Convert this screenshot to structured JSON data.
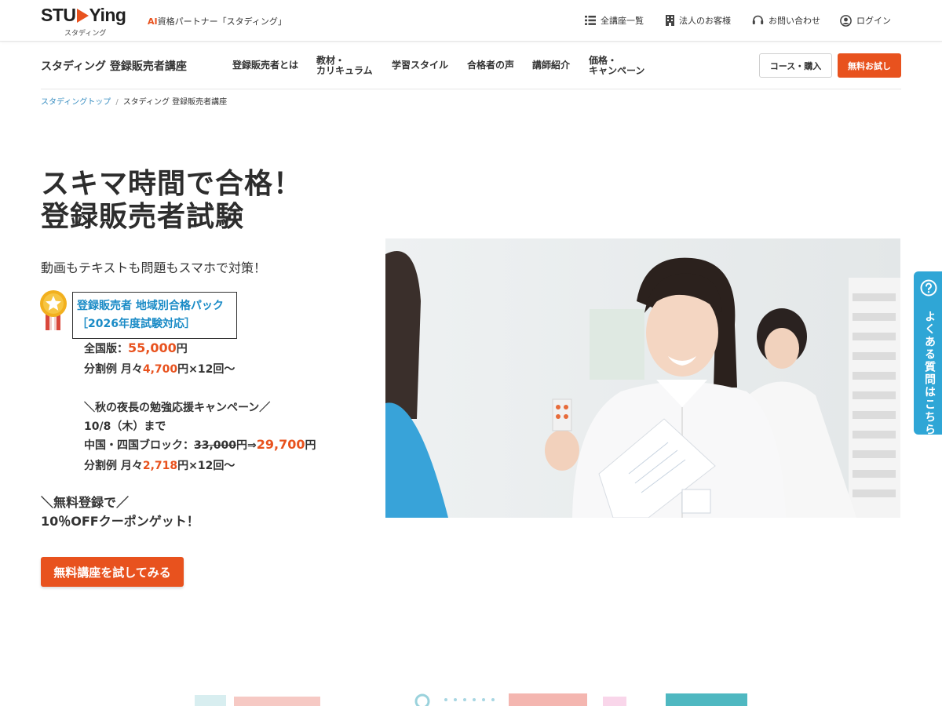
{
  "header": {
    "logo_word_1": "STU",
    "logo_word_2": "Ying",
    "logo_sub": "スタディング",
    "tagline_ai": "AI",
    "tagline_rest": "資格パートナー「スタディング」",
    "utility": [
      {
        "label": "全講座一覧",
        "icon": "list-icon"
      },
      {
        "label": "法人のお客様",
        "icon": "building-icon"
      },
      {
        "label": "お問い合わせ",
        "icon": "headset-icon"
      },
      {
        "label": "ログイン",
        "icon": "user-circle-icon"
      }
    ]
  },
  "course_nav": {
    "title": "スタディング 登録販売者講座",
    "items": [
      {
        "label": "登録販売者とは"
      },
      {
        "label": "教材・\nカリキュラム"
      },
      {
        "label": "学習スタイル"
      },
      {
        "label": "合格者の声"
      },
      {
        "label": "講師紹介"
      },
      {
        "label": "価格・\nキャンペーン"
      }
    ],
    "course_button": "コース・購入",
    "trial_button": "無料お試し"
  },
  "breadcrumb": {
    "home": "スタディングトップ",
    "separator": "/",
    "current": "スタディング 登録販売者講座"
  },
  "hero": {
    "title_line1": "スキマ時間で合格！",
    "title_line2": "登録販売者試験",
    "subtitle": "動画もテキストも問題もスマホで対策！",
    "pack_name": "登録販売者 地域別合格パック",
    "pack_year": "［2026年度試験対応］",
    "national_label": "全国版：",
    "national_price": "55,000",
    "yen": "円",
    "installment_label": "分割例 月々",
    "installment_price": "4,700",
    "installment_suffix": "円×12回～",
    "campaign_title": "＼秋の夜長の勉強応援キャンペーン／",
    "campaign_deadline": "10/8（木）まで",
    "region_label": "中国・四国ブロック：",
    "region_old_price": "33,000",
    "arrow": "⇒",
    "region_new_price": "29,700",
    "region_installment_price": "2,718",
    "promo_line1": "＼無料登録で／",
    "promo_line2": "10％OFFクーポンゲット！",
    "cta_label": "無料講座を試してみる"
  },
  "faq_tab": {
    "label": "よくある質問はこちら",
    "icon": "question-circle-icon"
  },
  "colors": {
    "accent": "#e8521e",
    "link_blue": "#3a8fc2",
    "pack_blue": "#1a8bc6",
    "faq_blue": "#2fa6d6",
    "medal_gold": "#f2b01e",
    "ribbon_red": "#d9473b"
  }
}
